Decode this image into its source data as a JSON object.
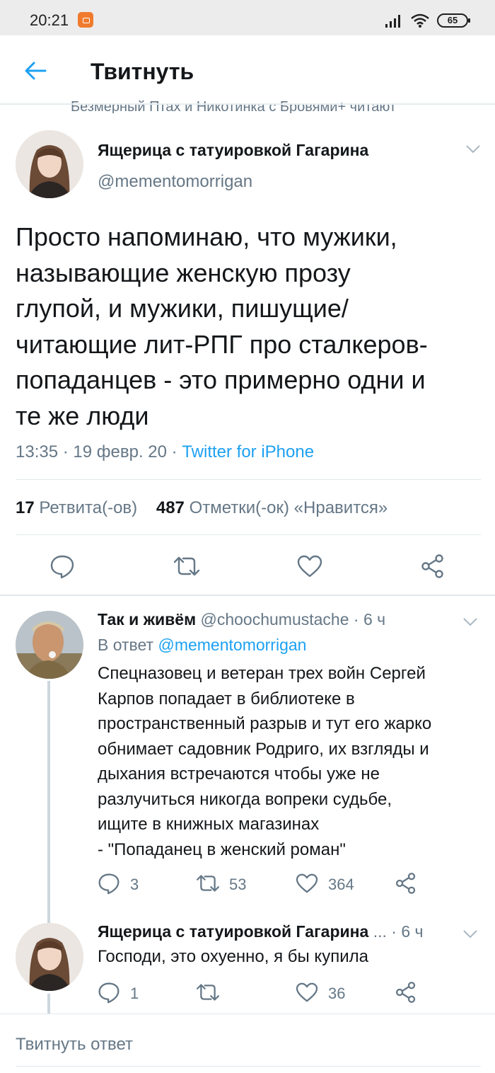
{
  "status_bar": {
    "time": "20:21",
    "battery": "65"
  },
  "header": {
    "title": "Твитнуть"
  },
  "social_context": {
    "text": "Безмерный Птах и Никотинка с Бровями+ читают"
  },
  "main_tweet": {
    "author_name": "Ящерица с татуировкой Гагарина",
    "author_handle": "@mementomorrigan",
    "text": "Просто напоминаю, что мужики,\nназывающие женскую прозу\nглупой, и мужики, пишущие/\nчитающие лит-РПГ про сталкеров-\nпопаданцев - это примерно одни и\nте же люди",
    "meta_time": "13:35 · 19 февр. 20 · ",
    "source": "Twitter for iPhone",
    "retweet_count": "17",
    "retweet_label": "Ретвита(-ов)",
    "like_count": "487",
    "like_label": "Отметки(-ок) «Нравится»"
  },
  "replies": [
    {
      "author_name": "Так и живём",
      "author_handle": "@choochumustache",
      "time": "· 6 ч",
      "reply_to_label": "В ответ ",
      "reply_to_handle": "@mementomorrigan",
      "text": "Спецназовец и ветеран трех войн Сергей\nКарпов попадает в библиотеке в\nпространственный разрыв и тут его жарко\nобнимает садовник Родриго, их взгляды и\nдыхания встречаются чтобы уже не\nразлучиться никогда вопреки судьбе,\nищите в книжных магазинах\n- \"Попаданец в женский роман\"",
      "reply_count": "3",
      "retweet_count": "53",
      "like_count": "364"
    },
    {
      "author_name": "Ящерица с татуировкой Гагарина",
      "author_handle_truncated": "...",
      "time": "· 6 ч",
      "text": "Господи, это охуенно, я бы купила",
      "reply_count": "1",
      "retweet_count": "",
      "like_count": "36"
    }
  ],
  "compose": {
    "placeholder": "Твитнуть ответ"
  },
  "colors": {
    "accent": "#1da1f2",
    "muted": "#657786",
    "text": "#14171a"
  }
}
